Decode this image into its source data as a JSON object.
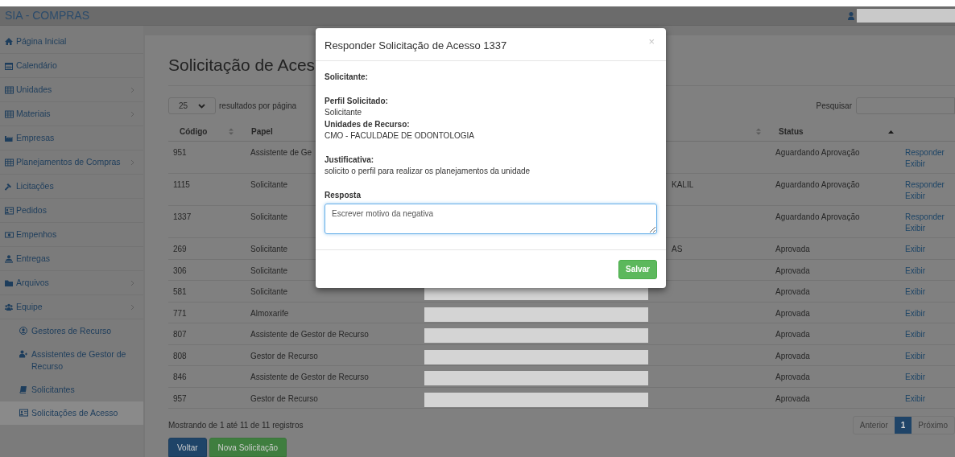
{
  "app": {
    "title": "SIA - COMPRAS"
  },
  "sidebar": {
    "items": [
      {
        "label": "Página Inicial",
        "submenu": false,
        "selected": false
      },
      {
        "label": "Calendário",
        "submenu": false,
        "selected": false
      },
      {
        "label": "Unidades",
        "submenu": true,
        "selected": false
      },
      {
        "label": "Materiais",
        "submenu": true,
        "selected": false
      },
      {
        "label": "Empresas",
        "submenu": false,
        "selected": false
      },
      {
        "label": "Planejamentos de Compras",
        "submenu": true,
        "selected": false
      },
      {
        "label": "Licitações",
        "submenu": false,
        "selected": false
      },
      {
        "label": "Pedidos",
        "submenu": false,
        "selected": false
      },
      {
        "label": "Empenhos",
        "submenu": false,
        "selected": false
      },
      {
        "label": "Entregas",
        "submenu": false,
        "selected": false
      },
      {
        "label": "Arquivos",
        "submenu": true,
        "selected": false
      },
      {
        "label": "Equipe",
        "submenu": true,
        "selected": false,
        "children": [
          {
            "label": "Gestores de Recurso",
            "selected": false
          },
          {
            "label": "Assistentes de Gestor de Recurso",
            "selected": false
          },
          {
            "label": "Solicitantes",
            "selected": false
          },
          {
            "label": "Solicitações de Acesso",
            "selected": true
          }
        ]
      }
    ]
  },
  "page": {
    "title": "Solicitação de Aces",
    "page_size": "25",
    "page_size_label": "resultados por página",
    "search_label": "Pesquisar",
    "table": {
      "columns": [
        {
          "label": "Código",
          "sortable": true,
          "sorted": false
        },
        {
          "label": "Papel",
          "sortable": false,
          "sorted": false
        },
        {
          "sortable": true,
          "sorted": false
        },
        {
          "label": "Status",
          "sortable": false,
          "sorted": true
        },
        {
          "sortable": false,
          "sorted": false
        }
      ],
      "rows": [
        {
          "codigo": "951",
          "papel": "Assistente de Ge",
          "status": "Aguardando Aprovação",
          "actions": [
            "Responder",
            "Exibir"
          ],
          "redacted": false
        },
        {
          "codigo": "1115",
          "papel": "Solicitante",
          "column_3": "KALIL",
          "status": "Aguardando Aprovação",
          "actions": [
            "Responder",
            "Exibir"
          ],
          "redacted": false
        },
        {
          "codigo": "1337",
          "papel": "Solicitante",
          "status": "Aguardando Aprovação",
          "actions": [
            "Responder",
            "Exibir"
          ],
          "redacted": false
        },
        {
          "codigo": "269",
          "papel": "Solicitante",
          "column_3": "AS",
          "status": "Aprovada",
          "actions": [
            "Exibir"
          ],
          "redacted": false
        },
        {
          "codigo": "306",
          "papel": "Solicitante",
          "status": "Aprovada",
          "actions": [
            "Exibir"
          ],
          "redacted": false
        },
        {
          "codigo": "581",
          "papel": "Solicitante",
          "status": "Aprovada",
          "actions": [
            "Exibir"
          ],
          "redacted": true
        },
        {
          "codigo": "771",
          "papel": "Almoxarife",
          "status": "Aprovada",
          "actions": [
            "Exibir"
          ],
          "redacted": true
        },
        {
          "codigo": "807",
          "papel": "Assistente de Gestor de Recurso",
          "status": "Aprovada",
          "actions": [
            "Exibir"
          ],
          "redacted": true
        },
        {
          "codigo": "808",
          "papel": "Gestor de Recurso",
          "status": "Aprovada",
          "actions": [
            "Exibir"
          ],
          "redacted": true
        },
        {
          "codigo": "846",
          "papel": "Assistente de Gestor de Recurso",
          "status": "Aprovada",
          "actions": [
            "Exibir"
          ],
          "redacted": true
        },
        {
          "codigo": "957",
          "papel": "Gestor de Recurso",
          "status": "Aprovada",
          "actions": [
            "Exibir"
          ],
          "redacted": true
        }
      ]
    },
    "info": "Mostrando de 1 até 11 de 11 registros",
    "pagination": [
      {
        "label": "Anterior",
        "selected": false
      },
      {
        "label": "1",
        "selected": true
      },
      {
        "label": "Próximo",
        "selected": false
      }
    ],
    "buttons": [
      {
        "label": "Voltar",
        "kind": "primary"
      },
      {
        "label": "Nova Solicitação",
        "kind": "success"
      }
    ]
  },
  "modal": {
    "title": "Responder Solicitação de Acesso 1337",
    "close": "×",
    "sections": [
      [
        {
          "label": "Solicitante:"
        }
      ],
      [
        {
          "label": "Perfil Solicitado:",
          "value": "Solicitante"
        },
        {
          "label": "Unidades de Recurso:",
          "value": "CMO - FACULDADE DE ODONTOLOGIA"
        }
      ],
      [
        {
          "label": "Justificativa:",
          "value": "solicito o perfil para realizar os planejamentos da unidade"
        }
      ]
    ],
    "answer_label": "Resposta",
    "answer_value": "Escrever motivo da negativa",
    "save": "Salvar"
  }
}
